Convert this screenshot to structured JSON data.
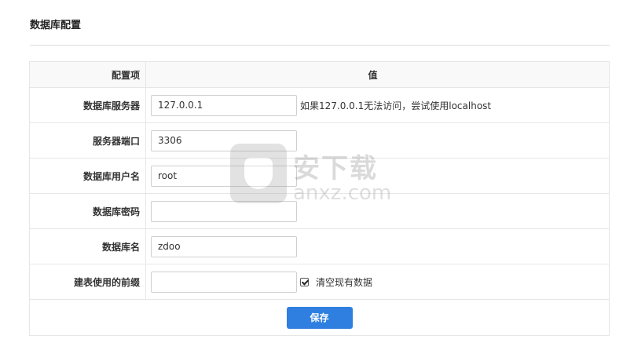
{
  "page": {
    "title": "数据库配置"
  },
  "table": {
    "header_label": "配置项",
    "header_value": "值"
  },
  "fields": {
    "host": {
      "label": "数据库服务器",
      "value": "127.0.0.1",
      "hint": "如果127.0.0.1无法访问，尝试使用localhost"
    },
    "port": {
      "label": "服务器端口",
      "value": "3306"
    },
    "user": {
      "label": "数据库用户名",
      "value": "root"
    },
    "password": {
      "label": "数据库密码",
      "value": ""
    },
    "dbname": {
      "label": "数据库名",
      "value": "zdoo"
    },
    "prefix": {
      "label": "建表使用的前缀",
      "value": "",
      "checkbox_label": "清空现有数据",
      "checkbox_checked": true
    }
  },
  "actions": {
    "save_label": "保存"
  },
  "watermark": {
    "text_top": "安下载",
    "text_bottom": "anxz.com",
    "logo_char": "安"
  },
  "colors": {
    "accent": "#2f7fe0",
    "border": "#e6e6e6",
    "header_bg": "#f9f9f9"
  }
}
